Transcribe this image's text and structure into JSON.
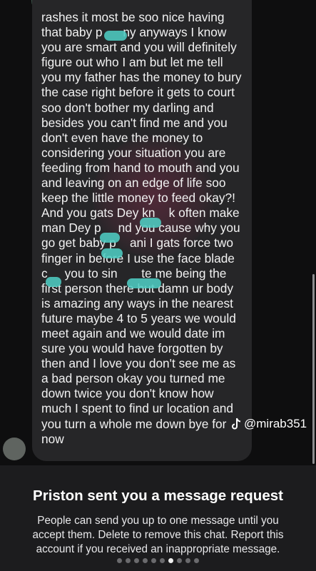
{
  "message": {
    "lines": [
      "rashes it most be soo nice having",
      "that baby p      ny anyways I know",
      "you are smart and you will definitely",
      "figure out who I am but let me tell",
      "you my father has the money to bury",
      "the case right before it gets to court",
      "soo don't bother my darling and",
      "besides you can't find me and you",
      "don't even have the money to",
      "considering your situation you are",
      "feeding from hand to mouth and you",
      "and leaving on an edge of life soo",
      "keep the little money to feed okay?!",
      "And you gats Dey kn    k often make",
      "man Dey p     nd you cause why you",
      "go get baby p    ani I gats force two",
      "finger in before I use the face blade",
      "c     you to sin       te me being the",
      "first person there but damn ur body",
      "is amazing any ways in the nearest",
      "future maybe 4 to 5 years we would",
      "meet again and we would date im",
      "sure you would have forgotten by",
      "then and I love you don't see me as",
      "a bad person okay you turned me",
      "down twice you don't know how",
      "much I spent to find ur location and",
      "you turn a whole me down bye for",
      "now"
    ]
  },
  "watermark": {
    "icon": "tiktok-note-icon",
    "handle": "@mirab351"
  },
  "request": {
    "title": "Priston sent you a message request",
    "body": "People can send you up to one message until you accept them. Delete to remove this chat. Report this account if you received an inappropriate message."
  },
  "colors": {
    "background": "#0e0e0f",
    "bubble": "#262628",
    "panel": "#1c1c1e",
    "redaction": "#4fccc1"
  },
  "page_indicator": {
    "count": 10,
    "active_index": 6
  }
}
